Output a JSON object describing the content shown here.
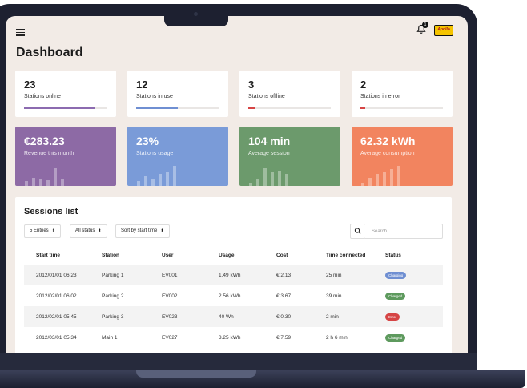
{
  "header": {
    "notification_count": "1",
    "logo_text": "Apollo",
    "title": "Dashboard"
  },
  "stats": [
    {
      "value": "23",
      "label": "Stations online",
      "progress": 0.85,
      "color": "#8c6bb0"
    },
    {
      "value": "12",
      "label": "Stations in use",
      "progress": 0.5,
      "color": "#6f8fd2"
    },
    {
      "value": "3",
      "label": "Stations offline",
      "progress": 0.08,
      "color": "#d64545"
    },
    {
      "value": "2",
      "label": "Stations in error",
      "progress": 0.06,
      "color": "#d64545"
    }
  ],
  "metrics": [
    {
      "value": "€283.23",
      "label": "Revenue this month",
      "color": "#8d6aa5",
      "bars": [
        0.2,
        0.35,
        0.3,
        0.25,
        0.75,
        0.3
      ]
    },
    {
      "value": "23%",
      "label": "Stations usage",
      "color": "#7a9bd8",
      "bars": [
        0.2,
        0.4,
        0.3,
        0.5,
        0.6,
        0.85
      ]
    },
    {
      "value": "104 min",
      "label": "Average session",
      "color": "#6c9a6c",
      "bars": [
        0.15,
        0.3,
        0.75,
        0.6,
        0.65,
        0.5
      ]
    },
    {
      "value": "62.32 kWh",
      "label": "Average consumption",
      "color": "#f2845f",
      "bars": [
        0.15,
        0.35,
        0.5,
        0.6,
        0.7,
        0.85
      ]
    }
  ],
  "sessions": {
    "title": "Sessions list",
    "filters": {
      "entries": "5 Entries",
      "status": "All status",
      "sort": "Sort by start time"
    },
    "search_placeholder": "Search",
    "columns": [
      "Start time",
      "Station",
      "User",
      "Usage",
      "Cost",
      "Time connected",
      "Status"
    ],
    "rows": [
      {
        "start": "2012/01/01 06:23",
        "station": "Parking 1",
        "user": "EV001",
        "usage": "1.49 kWh",
        "cost": "€ 2.13",
        "time": "25 min",
        "status": "Charging",
        "status_color": "#6f8fd2"
      },
      {
        "start": "2012/02/01 06:02",
        "station": "Parking 2",
        "user": "EV002",
        "usage": "2.56 kWh",
        "cost": "€ 3.67",
        "time": "39 min",
        "status": "Charged",
        "status_color": "#5e9a5e"
      },
      {
        "start": "2012/02/01 05:45",
        "station": "Parking 3",
        "user": "EV023",
        "usage": "40 Wh",
        "cost": "€ 0.30",
        "time": "2 min",
        "status": "Error",
        "status_color": "#d64545"
      },
      {
        "start": "2012/03/01 05:34",
        "station": "Main 1",
        "user": "EV027",
        "usage": "3.25 kWh",
        "cost": "€ 7.59",
        "time": "2 h 6 min",
        "status": "Charged",
        "status_color": "#5e9a5e"
      }
    ]
  }
}
